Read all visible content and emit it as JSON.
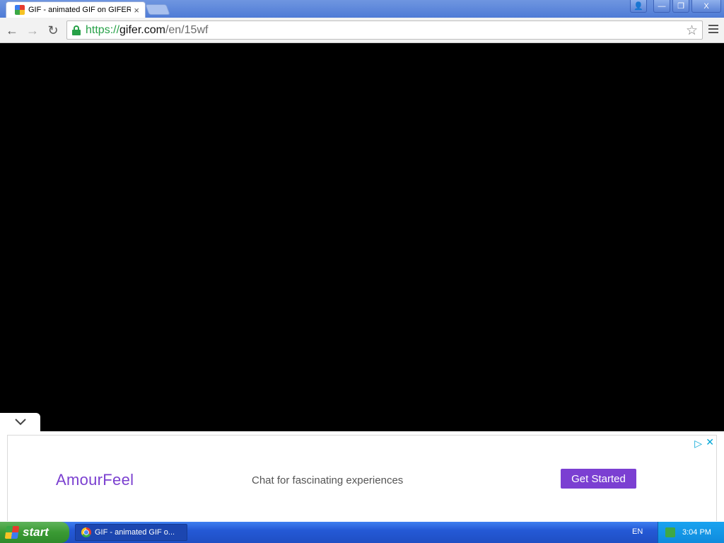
{
  "browser": {
    "tab": {
      "title": "GIF - animated GIF on GIFER",
      "close": "×"
    },
    "window_buttons": {
      "user": "👤",
      "minimize": "—",
      "restore": "❐",
      "close": "X"
    },
    "nav": {
      "back": "←",
      "forward": "→",
      "reload": "↻"
    },
    "address": {
      "scheme": "https://",
      "host": "gifer.com",
      "path": "/en/15wf"
    },
    "star": "☆"
  },
  "ad": {
    "collapse": "⌄",
    "brand": "AmourFeel",
    "tagline": "Chat for fascinating experiences",
    "cta": "Get Started",
    "adchoices": "▷",
    "close": "✕",
    "colors": {
      "brand": "#7b40d0",
      "cta_bg": "#7b3fd2",
      "choices": "#00a6d6"
    }
  },
  "taskbar": {
    "start": "start",
    "task_label": "GIF - animated GIF o...",
    "language": "EN",
    "clock": "3:04 PM"
  }
}
